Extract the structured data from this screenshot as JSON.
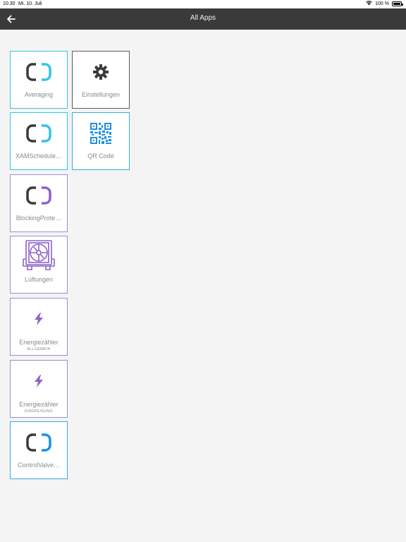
{
  "status": {
    "time": "10:30",
    "date": "Mi. 10. Juli",
    "battery": "100 %"
  },
  "nav": {
    "title": "All Apps"
  },
  "colors": {
    "cyan": "#36c3e6",
    "purple": "#8e62c8",
    "blue": "#1e8fe6",
    "dark": "#3a3a3a"
  },
  "apps": [
    {
      "label": "Averaging",
      "icon": "logo-icon"
    },
    {
      "label": "Einstellungen",
      "icon": "gear-icon"
    },
    {
      "label": "XAMSchedule…",
      "icon": "logo-icon"
    },
    {
      "label": "QR Code",
      "icon": "qr-code-icon"
    },
    {
      "label": "BlockingProte…",
      "icon": "logo-icon"
    },
    {
      "label": "Lüftungen",
      "icon": "ventilation-unit-icon"
    },
    {
      "label": "Energiezähler",
      "sub": "ALLGEMEIN",
      "icon": "lightning-icon"
    },
    {
      "label": "Energiezähler",
      "sub": "EINSPEISUNG",
      "icon": "lightning-icon"
    },
    {
      "label": "ControlValve…",
      "icon": "logo-icon"
    }
  ]
}
